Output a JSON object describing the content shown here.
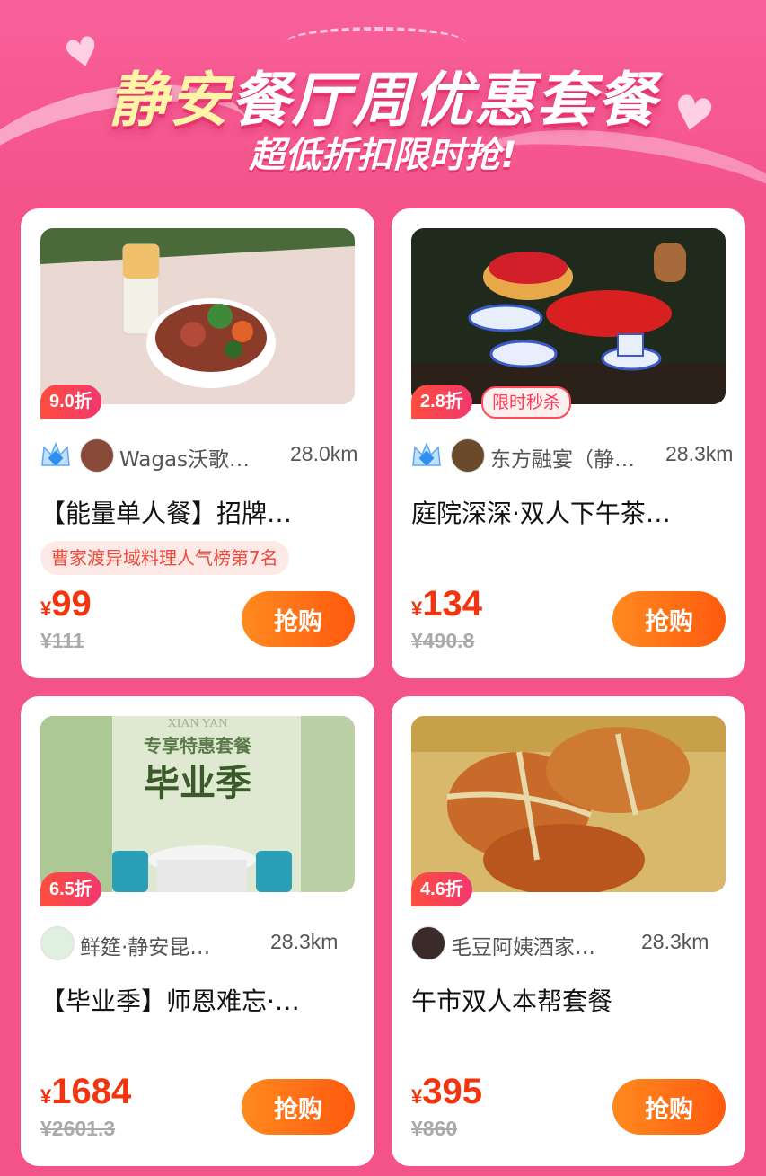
{
  "header": {
    "title_first": "静安",
    "title_rest": "餐厅周优惠套餐",
    "subtitle": "超低折扣限时抢!"
  },
  "cards": [
    {
      "discount": "9.0折",
      "shop_name": "Wagas沃歌…",
      "distance": "28.0km",
      "product": "【能量单人餐】招牌…",
      "tag": "曹家渡异域料理人气榜第7名",
      "currency": "¥",
      "price": "99",
      "original_price": "¥111",
      "buy_label": "抢购"
    },
    {
      "discount": "2.8折",
      "flash_label": "限时秒杀",
      "shop_name": "东方融宴（静…",
      "distance": "28.3km",
      "product": "庭院深深·双人下午茶…",
      "currency": "¥",
      "price": "134",
      "original_price": "¥490.8",
      "buy_label": "抢购"
    },
    {
      "discount": "6.5折",
      "photo_text_top": "XIAN YAN",
      "photo_text_mid": "专享特惠套餐",
      "photo_text_big": "毕业季",
      "shop_name": "鲜筵·静安昆…",
      "distance": "28.3km",
      "product": "【毕业季】师恩难忘·…",
      "currency": "¥",
      "price": "1684",
      "original_price": "¥2601.3",
      "buy_label": "抢购"
    },
    {
      "discount": "4.6折",
      "shop_name": "毛豆阿姨酒家…",
      "distance": "28.3km",
      "product": "午市双人本帮套餐",
      "currency": "¥",
      "price": "395",
      "original_price": "¥860",
      "buy_label": "抢购"
    }
  ],
  "colors": {
    "background": "#f4538a",
    "price": "#f2340f",
    "buy_button": "#ff6a12",
    "discount_badge": "#f2386e"
  },
  "icons": {
    "crown": "crown-icon",
    "heart": "heart-icon"
  }
}
